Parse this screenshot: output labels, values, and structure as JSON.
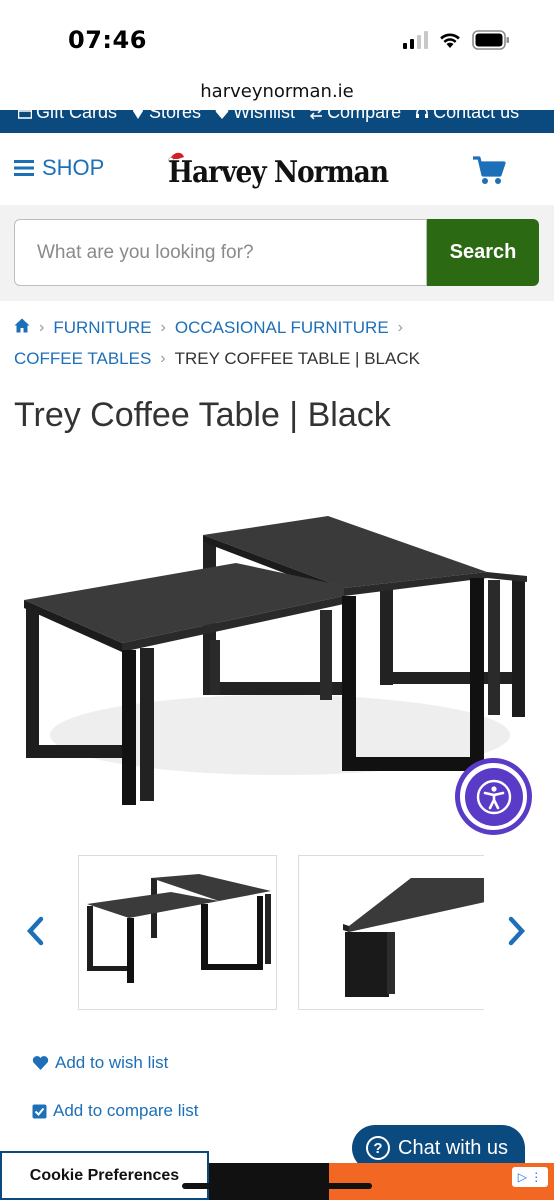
{
  "status_bar": {
    "time": "07:46"
  },
  "browser": {
    "url": "harveynorman.ie"
  },
  "utility_nav": {
    "items": [
      {
        "label": "Gift Cards",
        "icon": "gift-card-icon"
      },
      {
        "label": "Stores",
        "icon": "map-pin-icon"
      },
      {
        "label": "Wishlist",
        "icon": "heart-icon"
      },
      {
        "label": "Compare",
        "icon": "compare-arrows-icon"
      },
      {
        "label": "Contact us",
        "icon": "headset-icon"
      }
    ]
  },
  "header": {
    "shop_label": "SHOP",
    "logo_text": "Harvey Norman"
  },
  "search": {
    "placeholder": "What are you looking for?",
    "value": "",
    "button_label": "Search"
  },
  "breadcrumb": {
    "items": [
      "FURNITURE",
      "OCCASIONAL FURNITURE",
      "COFFEE TABLES"
    ],
    "current": "TREY COFFEE TABLE | BLACK"
  },
  "product": {
    "title": "Trey Coffee Table | Black"
  },
  "actions": {
    "wishlist_label": "Add to wish list",
    "compare_label": "Add to compare list"
  },
  "chat": {
    "label": "Chat with us"
  },
  "cookie": {
    "label": "Cookie Preferences"
  },
  "colors": {
    "brand_blue": "#0a4a7e",
    "link_blue": "#1d6fb8",
    "search_green": "#2b6a13",
    "accessibility_purple": "#5a3bc8",
    "ad_orange": "#f26722"
  }
}
